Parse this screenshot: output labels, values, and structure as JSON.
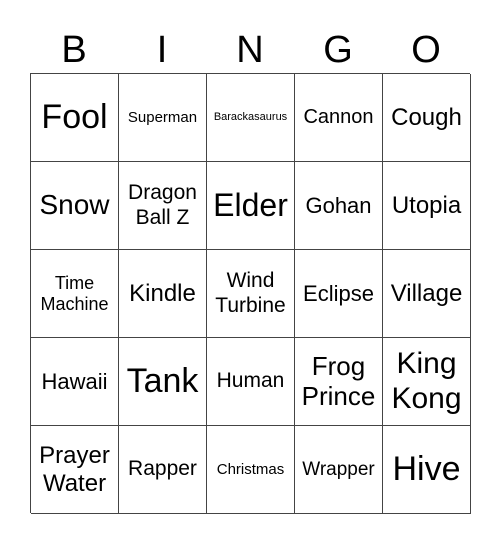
{
  "header": [
    "B",
    "I",
    "N",
    "G",
    "O"
  ],
  "cells": [
    "Fool",
    "Superman",
    "Barackasaurus",
    "Cannon",
    "Cough",
    "Snow",
    "Dragon\nBall Z",
    "Elder",
    "Gohan",
    "Utopia",
    "Time\nMachine",
    "Kindle",
    "Wind\nTurbine",
    "Eclipse",
    "Village",
    "Hawaii",
    "Tank",
    "Human",
    "Frog\nPrince",
    "King\nKong",
    "Prayer\nWater",
    "Rapper",
    "Christmas",
    "Wrapper",
    "Hive"
  ]
}
